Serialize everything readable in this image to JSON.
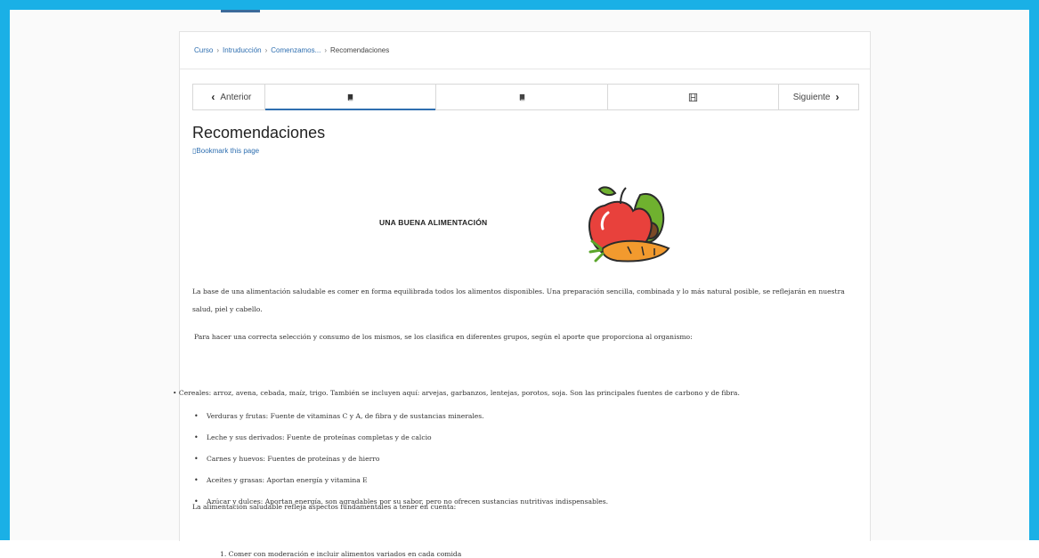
{
  "breadcrumb": {
    "items": [
      "Curso",
      "Intruducción",
      "Comenzamos..."
    ],
    "separator": "›",
    "current": "Recomendaciones"
  },
  "sequence_nav": {
    "prev_label": "Anterior",
    "next_label": "Siguiente",
    "units": [
      {
        "icon": "book-icon",
        "active": true
      },
      {
        "icon": "book-icon",
        "active": false
      },
      {
        "icon": "video-icon",
        "active": false
      }
    ]
  },
  "page": {
    "title": "Recomendaciones",
    "bookmark_label": "Bookmark this page",
    "image_title": "UNA BUENA ALIMENTACIÓN",
    "image_icon": "fruits-vegetables-icon"
  },
  "content": {
    "intro": "La base de una alimentación saludable es comer en forma equilibrada todos los alimentos disponibles. Una preparación sencilla, combinada y lo más natural posible, se reflejarán en nuestra salud, piel y cabello.",
    "groups_intro": "Para hacer una correcta selección y consumo de los mismos, se los clasifica en diferentes grupos, según el aporte que proporciona al organismo:",
    "first_bullet": "Cereales: arroz, avena, cebada, maíz, trigo. También se incluyen aquí: arvejas, garbanzos, lentejas, porotos, soja. Son las principales fuentes de carbono y de fibra.",
    "bullets": [
      "Verduras y frutas: Fuente de vitaminas C y A, de fibra y de sustancias minerales.",
      "Leche y sus derivados: Fuente de proteínas completas y de calcio",
      "Carnes y huevos: Fuentes de proteínas y de hierro",
      "Aceites y grasas: Aportan energía y vitamina E",
      "Azúcar y dulces: Aportan energía, son agradables por su sabor, pero no ofrecen sustancias nutritivas indispensables."
    ],
    "aspects_intro": "La alimentación saludable refleja aspectos fundamentales a tener en cuenta:",
    "numbered": [
      "Comer con moderación e incluir alimentos variados en cada comida"
    ]
  },
  "colors": {
    "frame": "#1ab0e6",
    "link": "#2f6fb0"
  }
}
